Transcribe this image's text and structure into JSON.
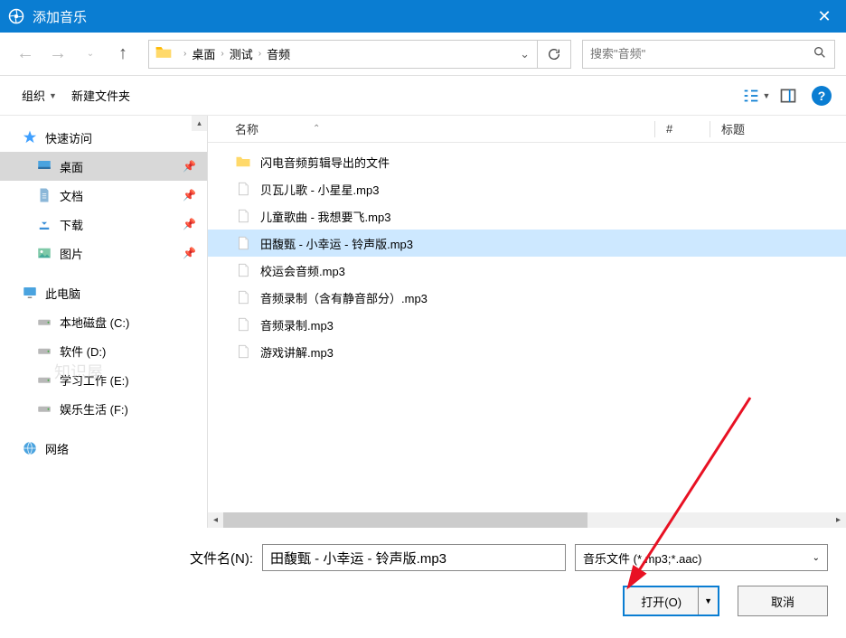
{
  "window": {
    "title": "添加音乐"
  },
  "nav": {
    "breadcrumb": [
      "桌面",
      "测试",
      "音频"
    ],
    "search_placeholder": "搜索\"音频\""
  },
  "toolbar": {
    "organize": "组织",
    "new_folder": "新建文件夹"
  },
  "sidebar": {
    "quick_access": "快速访问",
    "items_quick": [
      {
        "label": "桌面",
        "selected": true,
        "icon": "desktop"
      },
      {
        "label": "文档",
        "selected": false,
        "icon": "doc"
      },
      {
        "label": "下载",
        "selected": false,
        "icon": "download"
      },
      {
        "label": "图片",
        "selected": false,
        "icon": "image"
      }
    ],
    "this_pc": "此电脑",
    "drives": [
      {
        "label": "本地磁盘 (C:)"
      },
      {
        "label": "软件 (D:)"
      },
      {
        "label": "学习工作 (E:)"
      },
      {
        "label": "娱乐生活 (F:)"
      }
    ],
    "network": "网络",
    "watermark": "知识屋"
  },
  "filelist": {
    "columns": {
      "name": "名称",
      "num": "#",
      "title": "标题"
    },
    "rows": [
      {
        "name": "闪电音频剪辑导出的文件",
        "type": "folder",
        "selected": false
      },
      {
        "name": "贝瓦儿歌 - 小星星.mp3",
        "type": "file",
        "selected": false
      },
      {
        "name": "儿童歌曲 - 我想要飞.mp3",
        "type": "file",
        "selected": false
      },
      {
        "name": "田馥甄 - 小幸运 - 铃声版.mp3",
        "type": "file",
        "selected": true
      },
      {
        "name": "校运会音频.mp3",
        "type": "file",
        "selected": false
      },
      {
        "name": "音频录制（含有静音部分）.mp3",
        "type": "file",
        "selected": false
      },
      {
        "name": "音频录制.mp3",
        "type": "file",
        "selected": false
      },
      {
        "name": "游戏讲解.mp3",
        "type": "file",
        "selected": false
      }
    ]
  },
  "footer": {
    "filename_label": "文件名(N):",
    "filename_value": "田馥甄 - 小幸运 - 铃声版.mp3",
    "filter_label": "音乐文件 (*.mp3;*.aac)",
    "open_label": "打开(O)",
    "cancel_label": "取消"
  }
}
